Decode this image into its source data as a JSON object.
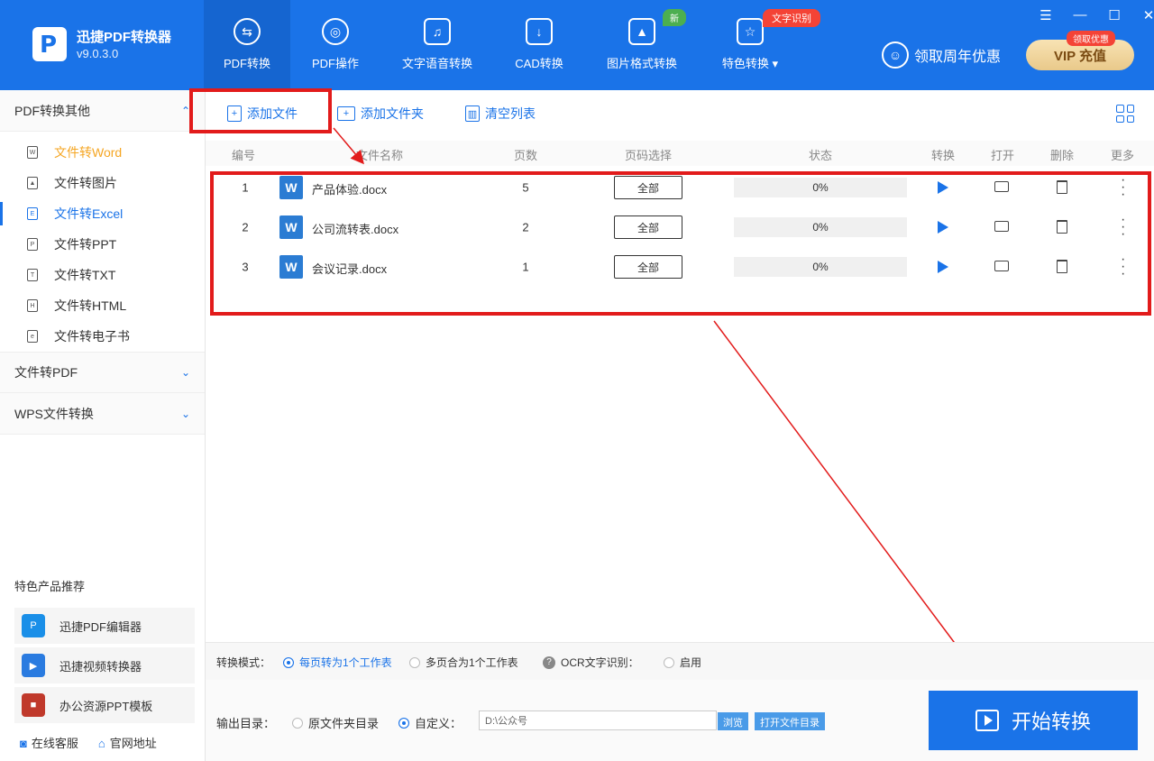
{
  "app": {
    "name": "迅捷PDF转换器",
    "version": "v9.0.3.0"
  },
  "tabs": [
    {
      "label": "PDF转换",
      "icon": "convert-icon"
    },
    {
      "label": "PDF操作",
      "icon": "pdf-operate-icon"
    },
    {
      "label": "文字语音转换",
      "icon": "voice-icon"
    },
    {
      "label": "CAD转换",
      "icon": "cad-icon"
    },
    {
      "label": "图片格式转换",
      "icon": "image-icon"
    },
    {
      "label": "特色转换",
      "icon": "feature-icon"
    }
  ],
  "badges": {
    "new": "新",
    "ocr": "文字识别"
  },
  "promo": {
    "label": "领取周年优惠"
  },
  "vip": {
    "label": "VIP 充值",
    "badge": "领取优惠"
  },
  "window_controls": [
    "☰",
    "—",
    "☐",
    "✕"
  ],
  "sidebar": {
    "group1": "PDF转换其他",
    "items": [
      {
        "label": "文件转Word"
      },
      {
        "label": "文件转图片"
      },
      {
        "label": "文件转Excel"
      },
      {
        "label": "文件转PPT"
      },
      {
        "label": "文件转TXT"
      },
      {
        "label": "文件转HTML"
      },
      {
        "label": "文件转电子书"
      }
    ],
    "group2": "文件转PDF",
    "group3": "WPS文件转换",
    "featured_title": "特色产品推荐",
    "featured": [
      {
        "label": "迅捷PDF编辑器"
      },
      {
        "label": "迅捷视频转换器"
      },
      {
        "label": "办公资源PPT模板"
      }
    ],
    "footer": {
      "service": "在线客服",
      "website": "官网地址"
    }
  },
  "toolbar": {
    "add_file": "添加文件",
    "add_folder": "添加文件夹",
    "clear_list": "清空列表"
  },
  "table": {
    "headers": [
      "编号",
      "文件名称",
      "页数",
      "页码选择",
      "状态",
      "转换",
      "打开",
      "删除",
      "更多"
    ],
    "rows": [
      {
        "num": "1",
        "name": "产品体验.docx",
        "pages": "5",
        "select": "全部",
        "status": "0%"
      },
      {
        "num": "2",
        "name": "公司流转表.docx",
        "pages": "2",
        "select": "全部",
        "status": "0%"
      },
      {
        "num": "3",
        "name": "会议记录.docx",
        "pages": "1",
        "select": "全部",
        "status": "0%"
      }
    ]
  },
  "mode": {
    "label": "转换模式：",
    "opt1": "每页转为1个工作表",
    "opt2": "多页合为1个工作表",
    "ocr_label": "OCR文字识别：",
    "ocr_enable": "启用"
  },
  "output": {
    "label": "输出目录：",
    "opt1": "原文件夹目录",
    "opt2": "自定义：",
    "path": "D:\\公众号",
    "browse": "浏览",
    "open_dir": "打开文件目录"
  },
  "start_button": "开始转换",
  "colors": {
    "brand": "#1a73e8",
    "annotation": "#e21b1b",
    "accent_orange": "#f5a623"
  }
}
